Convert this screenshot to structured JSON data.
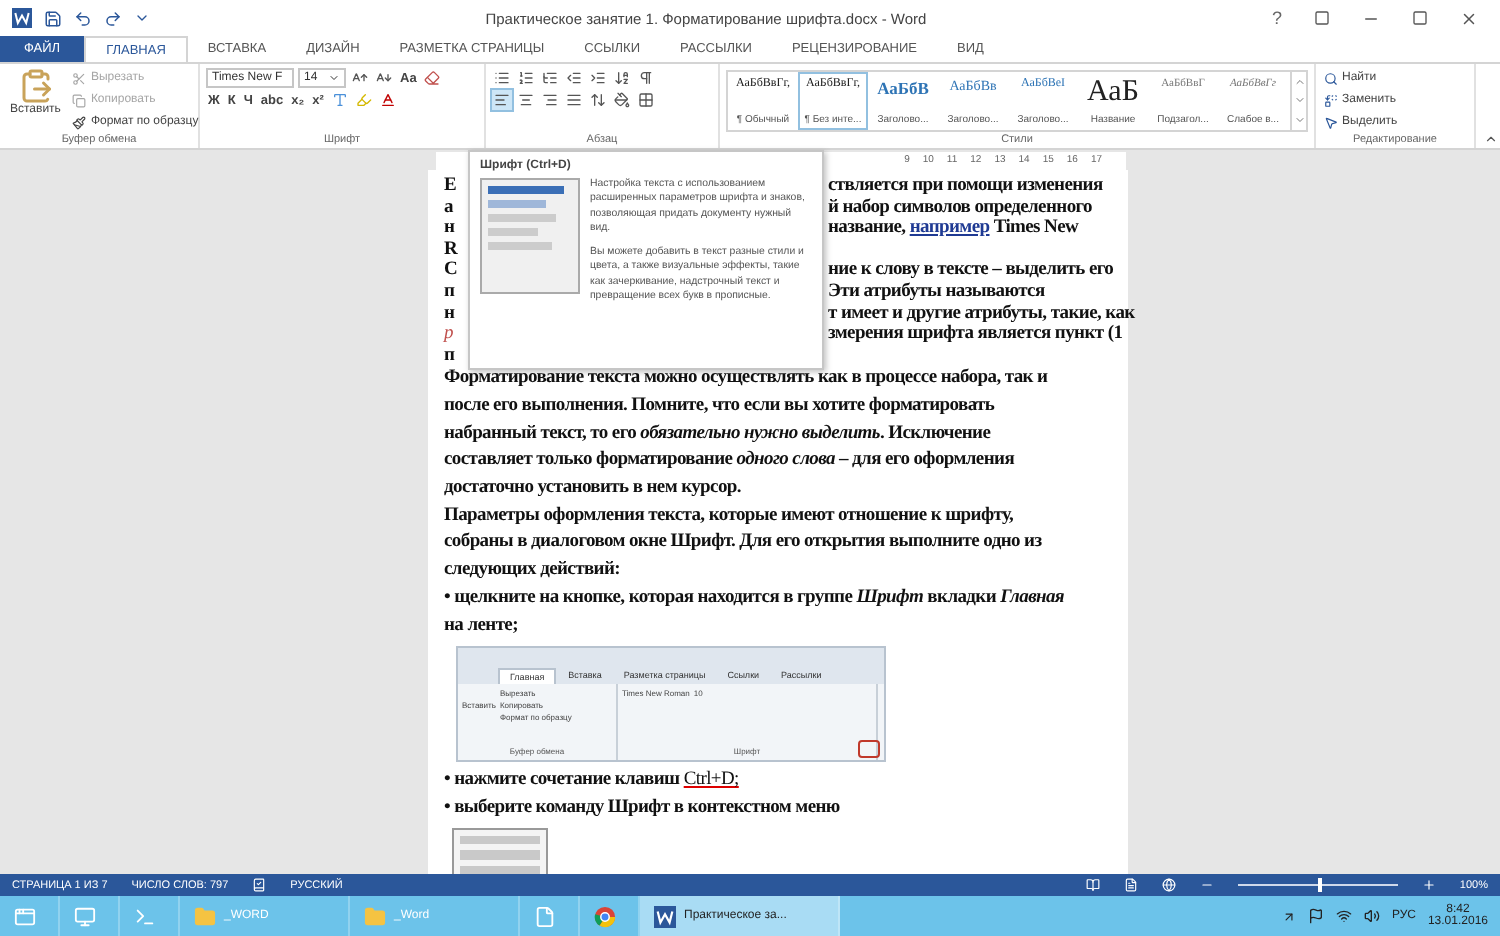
{
  "window": {
    "title": "Практическое занятие 1. Форматирование шрифта.docx - Word",
    "help": "?"
  },
  "ribbon_tabs": [
    {
      "label": "ФАЙЛ",
      "kind": "file",
      "selected": false
    },
    {
      "label": "ГЛАВНАЯ",
      "kind": "tab",
      "selected": true
    },
    {
      "label": "ВСТАВКА",
      "kind": "tab",
      "selected": false
    },
    {
      "label": "ДИЗАЙН",
      "kind": "tab",
      "selected": false
    },
    {
      "label": "РАЗМЕТКА СТРАНИЦЫ",
      "kind": "tab",
      "selected": false
    },
    {
      "label": "ССЫЛКИ",
      "kind": "tab",
      "selected": false
    },
    {
      "label": "РАССЫЛКИ",
      "kind": "tab",
      "selected": false
    },
    {
      "label": "РЕЦЕНЗИРОВАНИЕ",
      "kind": "tab",
      "selected": false
    },
    {
      "label": "ВИД",
      "kind": "tab",
      "selected": false
    }
  ],
  "clipboard": {
    "paste": "Вставить",
    "group_label": "Буфер обмена",
    "items": [
      {
        "kind": "cut",
        "label": "Вырезать",
        "disabled": true
      },
      {
        "kind": "copy",
        "label": "Копировать",
        "disabled": true
      },
      {
        "kind": "painter",
        "label": "Формат по образцу",
        "disabled": false
      }
    ]
  },
  "font": {
    "name": "Times New F",
    "size": "14",
    "case_button": "Aa",
    "format_buttons": [
      "Ж",
      "К",
      "Ч",
      "abc",
      "x₂",
      "x²"
    ],
    "group_label": "Шрифт"
  },
  "paragraph": {
    "group_label": "Абзац",
    "align_buttons": [
      {
        "kind": "left",
        "selected": true
      },
      {
        "kind": "center",
        "selected": false
      },
      {
        "kind": "right",
        "selected": false
      },
      {
        "kind": "justify",
        "selected": false
      }
    ]
  },
  "styles": {
    "group_label": "Стили",
    "items": [
      {
        "kind": "normal",
        "sample": "АаБбВвГг,",
        "name": "¶ Обычный",
        "selected": false
      },
      {
        "kind": "normal",
        "sample": "АаБбВвГг,",
        "name": "¶ Без инте...",
        "selected": true
      },
      {
        "kind": "heading1",
        "sample": "АаБбВ",
        "name": "Заголово...",
        "selected": false
      },
      {
        "kind": "heading2",
        "sample": "АаБбВв",
        "name": "Заголово...",
        "selected": false
      },
      {
        "kind": "heading3",
        "sample": "АаБбВеІ",
        "name": "Заголово...",
        "selected": false
      },
      {
        "kind": "title",
        "sample": "АаБ",
        "name": "Название",
        "selected": false
      },
      {
        "kind": "subtitle",
        "sample": "АаБбВвГ",
        "name": "Подзагол...",
        "selected": false
      },
      {
        "kind": "subtle",
        "sample": "АаБбВвГг",
        "name": "Слабое в...",
        "selected": false
      }
    ]
  },
  "editing": {
    "group_label": "Редактирование",
    "items": [
      {
        "kind": "find",
        "label": "Найти"
      },
      {
        "kind": "replace",
        "label": "Заменить"
      },
      {
        "kind": "select",
        "label": "Выделить"
      }
    ]
  },
  "ruler": {
    "numbers": [
      "9",
      "10",
      "11",
      "12",
      "13",
      "14",
      "15",
      "16",
      "17"
    ]
  },
  "tooltip": {
    "title": "Шрифт (Ctrl+D)",
    "paragraphs": [
      "Настройка текста с использованием расширенных параметров шрифта и знаков, позволяющая придать документу нужный вид.",
      "Вы можете добавить в текст разные стили и цвета, а также визуальные эффекты, такие как зачеркивание, надстрочный текст и превращение всех букв в прописные."
    ]
  },
  "document": {
    "partial_lines": [
      {
        "kind": "plain",
        "left": "Е",
        "right": "ствляется при помощи изменения"
      },
      {
        "kind": "plain",
        "left": "а",
        "right": "й набор символов определенного"
      },
      {
        "kind": "plain",
        "left": "н",
        "right": "название, ",
        "link": "например",
        "after": " Times New"
      },
      {
        "kind": "plain",
        "left": "R"
      },
      {
        "kind": "plain",
        "left": "С",
        "right": "ние к слову в тексте – выделить его"
      },
      {
        "kind": "plain",
        "left": "п",
        "right": "Эти атрибуты называются"
      },
      {
        "kind": "plain",
        "left": "н",
        "right": "т имеет и другие атрибуты, такие, как"
      },
      {
        "kind": "accent",
        "left": "р",
        "right": "змерения шрифта является пункт (1"
      },
      {
        "kind": "plain",
        "left": "п"
      }
    ],
    "lines": [
      "Форматирование текста можно осуществлять как в процессе набора, так и",
      "после его выполнения. Помните, что если вы хотите форматировать",
      "набранный текст, то его *обязательно нужно выделить*. Исключение",
      "составляет только форматирование *одного слова* – для его оформления",
      "достаточно установить в нем курсор.",
      "Параметры оформления текста, которые имеют отношение к шрифту,",
      "собраны в диалоговом окне Шрифт. Для его открытия выполните одно из",
      "следующих действий:",
      "• щелкните на кнопке, которая находится в группе *Шрифт* вкладки *Главная*",
      "на ленте;"
    ],
    "ribbon_image": {
      "tabs": [
        {
          "label": "Главная",
          "selected": true
        },
        {
          "label": "Вставка",
          "selected": false
        },
        {
          "label": "Разметка страницы",
          "selected": false
        },
        {
          "label": "Ссылки",
          "selected": false
        },
        {
          "label": "Рассылки",
          "selected": false
        }
      ],
      "paste": "Вставить",
      "clipboard_items": [
        "Вырезать",
        "Копировать",
        "Формат по образцу"
      ],
      "font_name": "Times New Roman",
      "font_size": "10",
      "group_labels": [
        "Буфер обмена",
        "Шрифт"
      ]
    },
    "after_lines": [
      {
        "text": "• нажмите сочетание клавиш ",
        "shortcut": "Ctrl+D;"
      },
      {
        "text": "• выберите команду Шрифт в контекстном меню"
      }
    ]
  },
  "status_bar": {
    "page": "СТРАНИЦА 1 ИЗ 7",
    "words": "ЧИСЛО СЛОВ: 797",
    "language": "РУССКИЙ",
    "zoom": {
      "level": 0.5,
      "reading": "100%"
    }
  },
  "taskbar": {
    "items": [
      {
        "kind": "start",
        "selected": false
      },
      {
        "kind": "computer",
        "selected": false
      },
      {
        "kind": "shell",
        "selected": false
      },
      {
        "kind": "folder",
        "label": "_WORD",
        "selected": false
      },
      {
        "kind": "folder",
        "label": "_Word",
        "selected": false
      },
      {
        "kind": "document",
        "selected": false
      },
      {
        "kind": "browser",
        "selected": false
      },
      {
        "kind": "word",
        "label": "Практическое за...",
        "selected": true
      }
    ],
    "language": "РУС",
    "time": "8:42",
    "date": "13.01.2016"
  }
}
